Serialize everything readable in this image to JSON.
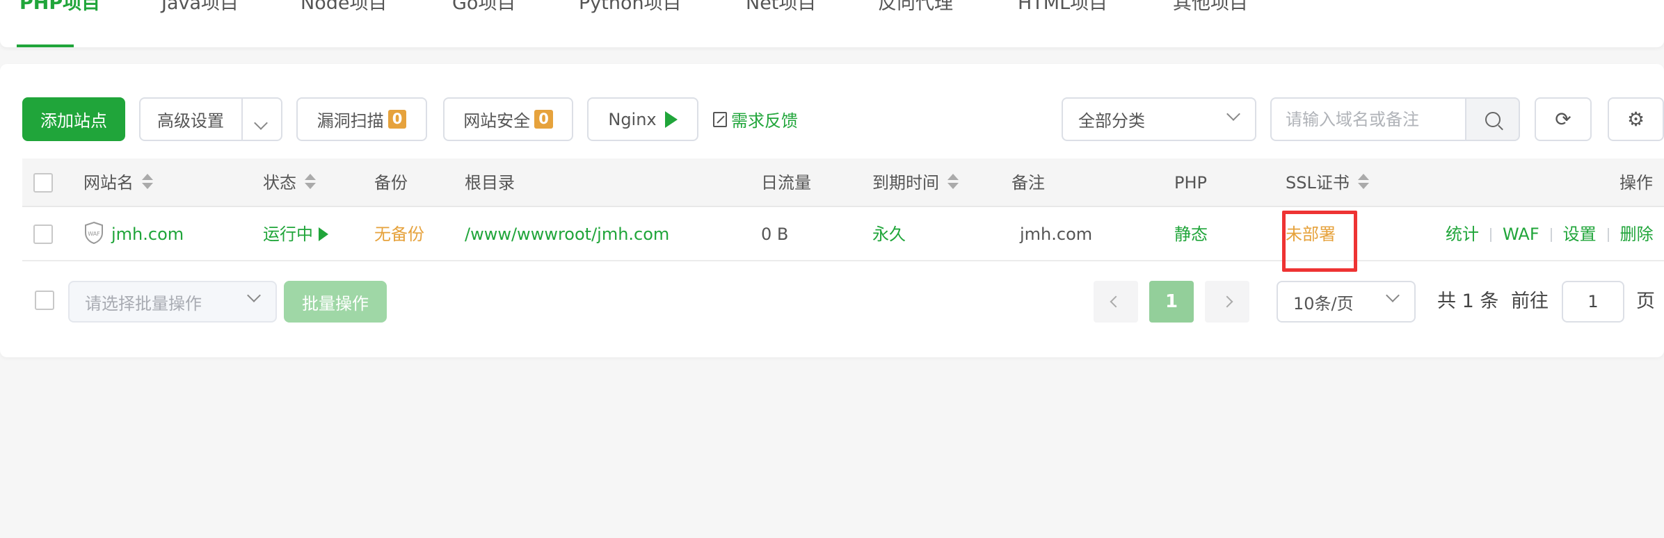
{
  "tabs": [
    {
      "label": "PHP项目",
      "active": true
    },
    {
      "label": "Java项目"
    },
    {
      "label": "Node项目"
    },
    {
      "label": "Go项目"
    },
    {
      "label": "Python项目"
    },
    {
      "label": "Net项目"
    },
    {
      "label": "反向代理"
    },
    {
      "label": "HTML项目"
    },
    {
      "label": "其他项目"
    }
  ],
  "toolbar": {
    "add_site": "添加站点",
    "advanced": "高级设置",
    "vuln_scan": "漏洞扫描",
    "vuln_count": "0",
    "site_security": "网站安全",
    "security_count": "0",
    "nginx": "Nginx",
    "feedback": "需求反馈",
    "category": "全部分类",
    "search_placeholder": "请输入域名或备注"
  },
  "table": {
    "headers": {
      "name": "网站名",
      "status": "状态",
      "backup": "备份",
      "root": "根目录",
      "traffic": "日流量",
      "expire": "到期时间",
      "remark": "备注",
      "php": "PHP",
      "ssl": "SSL证书",
      "actions": "操作"
    },
    "rows": [
      {
        "name": "jmh.com",
        "status": "运行中",
        "backup": "无备份",
        "root": "/www/wwwroot/jmh.com",
        "traffic": "0 B",
        "expire": "永久",
        "remark": "jmh.com",
        "php": "静态",
        "ssl": "未部署",
        "waf_badge": "WAF",
        "actions": {
          "stats": "统计",
          "waf": "WAF",
          "settings": "设置",
          "delete": "删除"
        }
      }
    ]
  },
  "footer": {
    "batch_placeholder": "请选择批量操作",
    "batch_button": "批量操作",
    "current_page": "1",
    "page_size": "10条/页",
    "total": "共 1 条",
    "goto_label": "前往",
    "goto_value": "1",
    "page_unit": "页"
  },
  "colors": {
    "primary": "#20a53a",
    "warning": "#e6a23c",
    "highlight": "#ee3333"
  }
}
